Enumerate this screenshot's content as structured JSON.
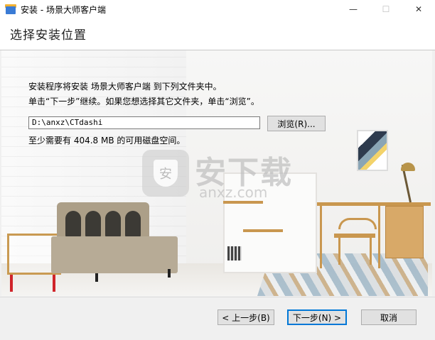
{
  "window": {
    "title": "安装 - 场景大师客户端",
    "minimize": "—",
    "maximize": "☐",
    "close": "✕"
  },
  "header": {
    "title": "选择安装位置"
  },
  "body": {
    "line1": "安装程序将安装 场景大师客户端 到下列文件夹中。",
    "line2": "单击“下一步”继续。如果您想选择其它文件夹，单击“浏览”。",
    "path_value": "D:\\anxz\\CTdashi",
    "browse_label": "浏览(R)...",
    "space_text": "至少需要有 404.8 MB 的可用磁盘空间。"
  },
  "watermark": {
    "shield_glyph": "安",
    "big": "安下载",
    "small": "anxz.com"
  },
  "footer": {
    "back_label": "< 上一步(B)",
    "next_label": "下一步(N) >",
    "cancel_label": "取消"
  }
}
